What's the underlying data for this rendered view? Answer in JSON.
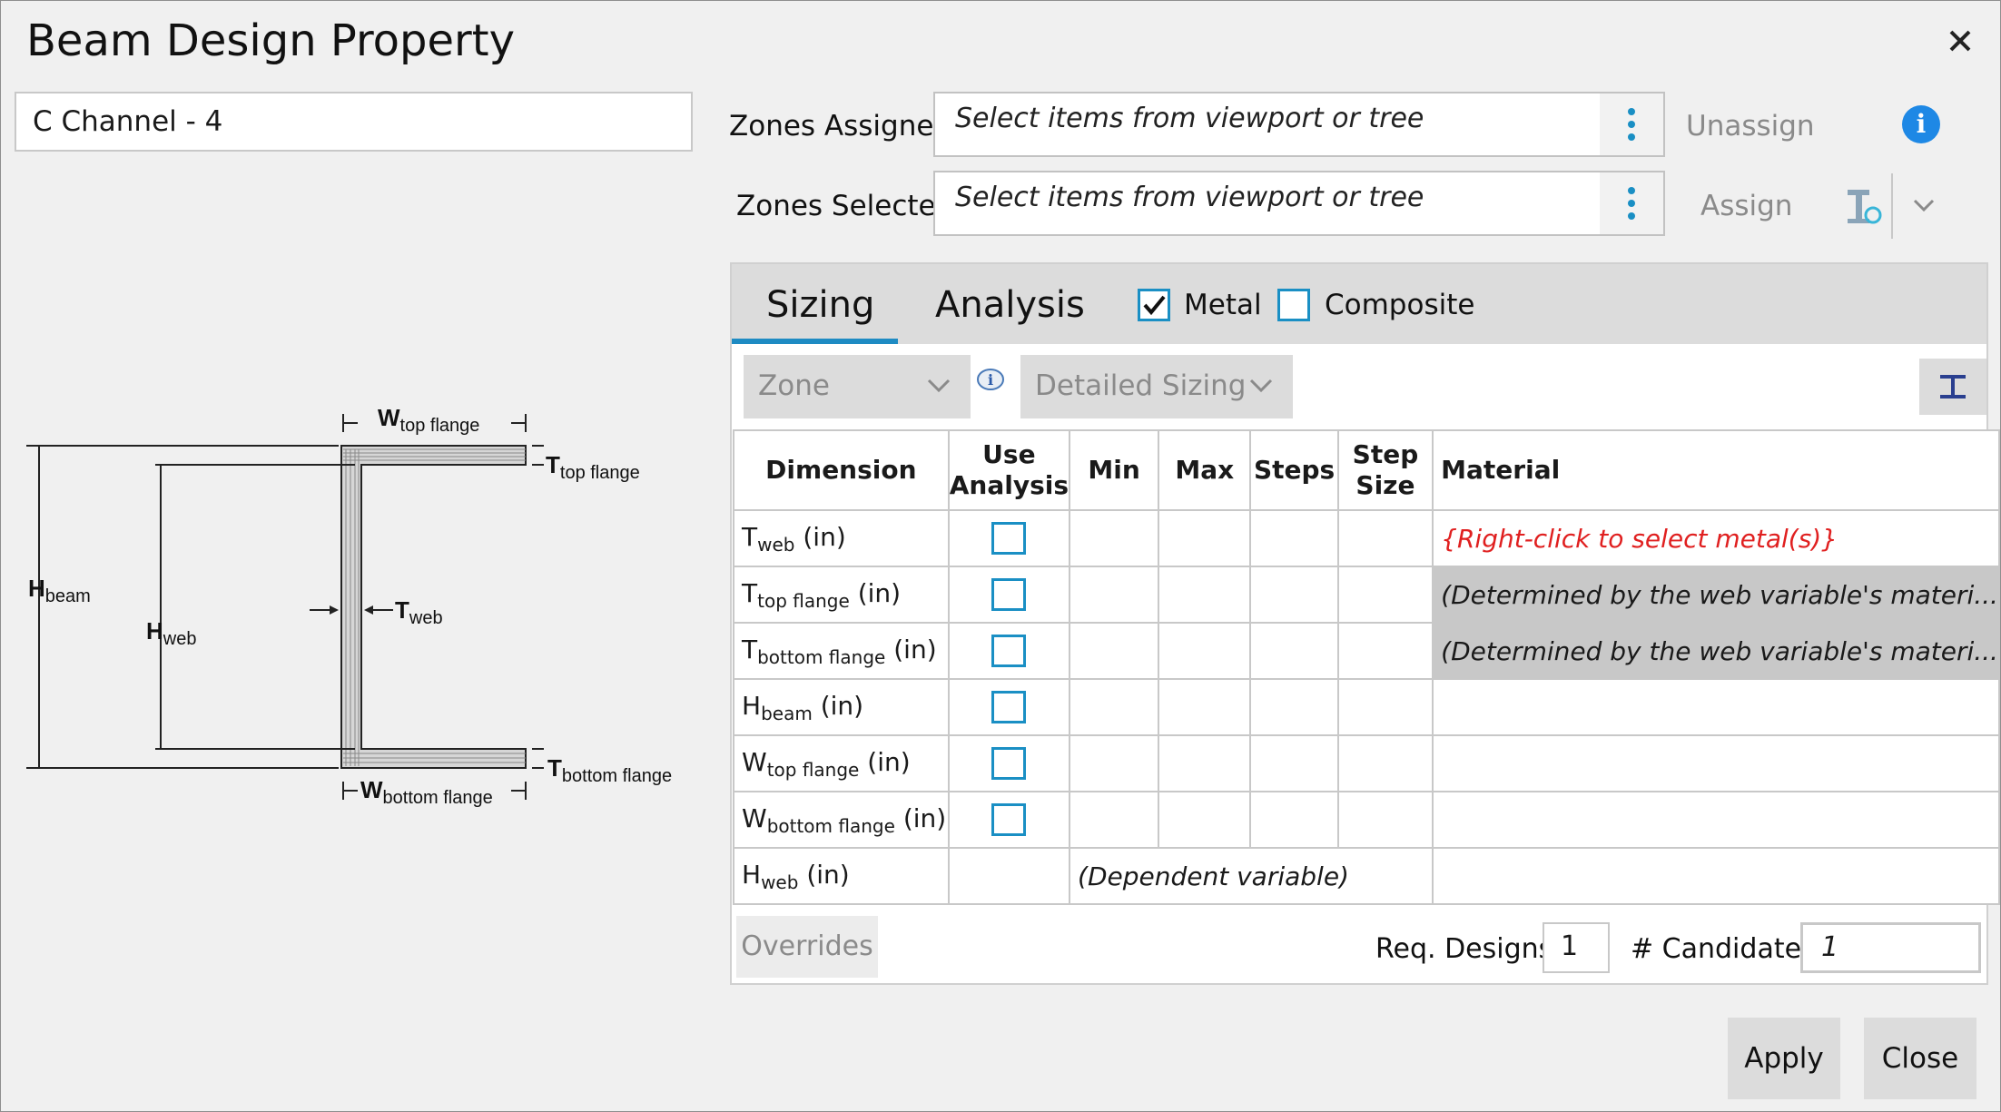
{
  "window": {
    "title": "Beam Design Property",
    "close_icon": "close-icon"
  },
  "property_name": "C Channel - 4",
  "zones_assigned": {
    "label": "Zones Assigned:",
    "placeholder": "Select items from viewport or tree",
    "action": "Unassign"
  },
  "zones_selected": {
    "label": "Zones Selected:",
    "placeholder": "Select items from viewport or tree",
    "action": "Assign"
  },
  "tabs": [
    {
      "label": "Sizing",
      "active": true
    },
    {
      "label": "Analysis",
      "active": false
    }
  ],
  "checkboxes": {
    "metal": {
      "label": "Metal",
      "checked": true
    },
    "composite": {
      "label": "Composite",
      "checked": false
    }
  },
  "dropdowns": {
    "zone": "Zone",
    "sizing": "Detailed Sizing"
  },
  "table": {
    "headers": {
      "dimension": "Dimension",
      "use": "Use",
      "analysis": "Analysis",
      "min": "Min",
      "max": "Max",
      "steps": "Steps",
      "step": "Step",
      "size": "Size",
      "material": "Material"
    },
    "unit": "(in)",
    "rows": [
      {
        "sym": "T",
        "sub": "web",
        "material": "{Right-click to select metal(s)}"
      },
      {
        "sym": "T",
        "sub": "top flange",
        "material": "(Determined by the web variable's materi..."
      },
      {
        "sym": "T",
        "sub": "bottom flange",
        "material": "(Determined by the web variable's materi..."
      },
      {
        "sym": "H",
        "sub": "beam",
        "material": ""
      },
      {
        "sym": "W",
        "sub": "top flange",
        "material": ""
      },
      {
        "sym": "W",
        "sub": "bottom flange",
        "material": ""
      },
      {
        "sym": "H",
        "sub": "web",
        "dependent": "(Dependent variable)"
      }
    ]
  },
  "footer": {
    "overrides": "Overrides",
    "req_designs_label": "Req. Designs",
    "req_designs_value": "1",
    "candidates_label": "# Candidates",
    "candidates_value": "1"
  },
  "buttons": {
    "apply": "Apply",
    "close": "Close"
  },
  "diagram": {
    "w_top": {
      "sym": "W",
      "sub": "top flange"
    },
    "t_top": {
      "sym": "T",
      "sub": "top flange"
    },
    "h_beam": {
      "sym": "H",
      "sub": "beam"
    },
    "h_web": {
      "sym": "H",
      "sub": "web"
    },
    "t_web": {
      "sym": "T",
      "sub": "web"
    },
    "w_bottom": {
      "sym": "W",
      "sub": "bottom flange"
    },
    "t_bottom": {
      "sym": "T",
      "sub": "bottom flange"
    }
  },
  "colors": {
    "accent": "#1e8bc3",
    "error_text": "#e02020",
    "info": "#1e88e5"
  }
}
